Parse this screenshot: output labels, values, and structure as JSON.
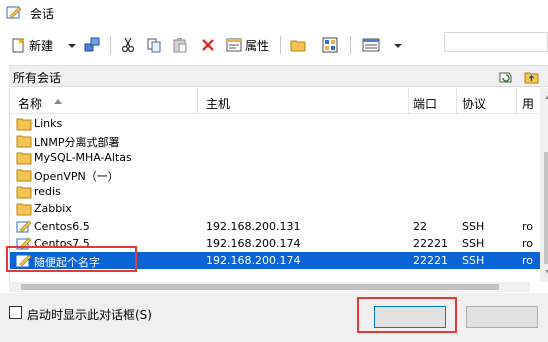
{
  "window": {
    "title": "会话"
  },
  "toolbar": {
    "new_label": "新建",
    "properties_label": "属性"
  },
  "folder_path": "所有会话",
  "table": {
    "columns": [
      "名称",
      "主机",
      "端口",
      "协议",
      "用"
    ],
    "folders": [
      "Links",
      "LNMP分离式部署",
      "MySQL-MHA-Altas",
      "OpenVPN（一）",
      "redis",
      "Zabbix"
    ],
    "sessions": [
      {
        "name": "Centos6.5",
        "host": "192.168.200.131",
        "port": "22",
        "protocol": "SSH",
        "user": "ro"
      },
      {
        "name": "Centos7.5",
        "host": "192.168.200.174",
        "port": "22221",
        "protocol": "SSH",
        "user": "ro"
      },
      {
        "name": "随便起个名字",
        "host": "192.168.200.174",
        "port": "22221",
        "protocol": "SSH",
        "user": "ro"
      }
    ]
  },
  "footer": {
    "checkbox_label": "启动时显示此对话框(S)",
    "connect_label": "",
    "close_label": ""
  },
  "colors": {
    "selection": "#0a64d6",
    "highlight_box": "#e53935",
    "folder": "#e8b84a"
  }
}
